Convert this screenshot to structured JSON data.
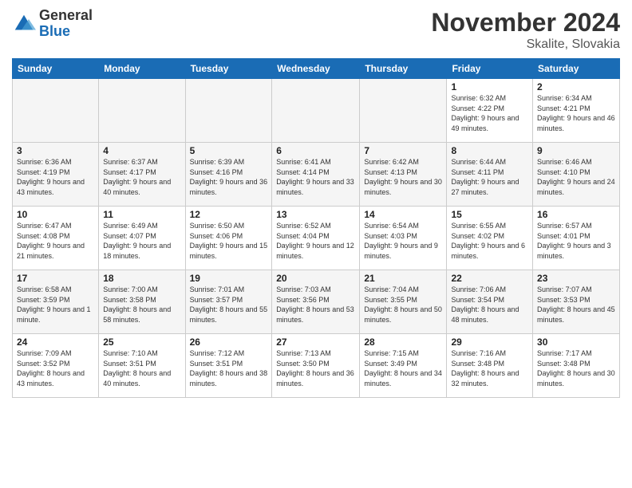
{
  "header": {
    "logo_text_general": "General",
    "logo_text_blue": "Blue",
    "month_title": "November 2024",
    "location": "Skalite, Slovakia"
  },
  "days_of_week": [
    "Sunday",
    "Monday",
    "Tuesday",
    "Wednesday",
    "Thursday",
    "Friday",
    "Saturday"
  ],
  "weeks": [
    [
      {
        "day": "",
        "empty": true
      },
      {
        "day": "",
        "empty": true
      },
      {
        "day": "",
        "empty": true
      },
      {
        "day": "",
        "empty": true
      },
      {
        "day": "",
        "empty": true
      },
      {
        "day": "1",
        "sunrise": "6:32 AM",
        "sunset": "4:22 PM",
        "daylight": "9 hours and 49 minutes."
      },
      {
        "day": "2",
        "sunrise": "6:34 AM",
        "sunset": "4:21 PM",
        "daylight": "9 hours and 46 minutes."
      }
    ],
    [
      {
        "day": "3",
        "sunrise": "6:36 AM",
        "sunset": "4:19 PM",
        "daylight": "9 hours and 43 minutes."
      },
      {
        "day": "4",
        "sunrise": "6:37 AM",
        "sunset": "4:17 PM",
        "daylight": "9 hours and 40 minutes."
      },
      {
        "day": "5",
        "sunrise": "6:39 AM",
        "sunset": "4:16 PM",
        "daylight": "9 hours and 36 minutes."
      },
      {
        "day": "6",
        "sunrise": "6:41 AM",
        "sunset": "4:14 PM",
        "daylight": "9 hours and 33 minutes."
      },
      {
        "day": "7",
        "sunrise": "6:42 AM",
        "sunset": "4:13 PM",
        "daylight": "9 hours and 30 minutes."
      },
      {
        "day": "8",
        "sunrise": "6:44 AM",
        "sunset": "4:11 PM",
        "daylight": "9 hours and 27 minutes."
      },
      {
        "day": "9",
        "sunrise": "6:46 AM",
        "sunset": "4:10 PM",
        "daylight": "9 hours and 24 minutes."
      }
    ],
    [
      {
        "day": "10",
        "sunrise": "6:47 AM",
        "sunset": "4:08 PM",
        "daylight": "9 hours and 21 minutes."
      },
      {
        "day": "11",
        "sunrise": "6:49 AM",
        "sunset": "4:07 PM",
        "daylight": "9 hours and 18 minutes."
      },
      {
        "day": "12",
        "sunrise": "6:50 AM",
        "sunset": "4:06 PM",
        "daylight": "9 hours and 15 minutes."
      },
      {
        "day": "13",
        "sunrise": "6:52 AM",
        "sunset": "4:04 PM",
        "daylight": "9 hours and 12 minutes."
      },
      {
        "day": "14",
        "sunrise": "6:54 AM",
        "sunset": "4:03 PM",
        "daylight": "9 hours and 9 minutes."
      },
      {
        "day": "15",
        "sunrise": "6:55 AM",
        "sunset": "4:02 PM",
        "daylight": "9 hours and 6 minutes."
      },
      {
        "day": "16",
        "sunrise": "6:57 AM",
        "sunset": "4:01 PM",
        "daylight": "9 hours and 3 minutes."
      }
    ],
    [
      {
        "day": "17",
        "sunrise": "6:58 AM",
        "sunset": "3:59 PM",
        "daylight": "9 hours and 1 minute."
      },
      {
        "day": "18",
        "sunrise": "7:00 AM",
        "sunset": "3:58 PM",
        "daylight": "8 hours and 58 minutes."
      },
      {
        "day": "19",
        "sunrise": "7:01 AM",
        "sunset": "3:57 PM",
        "daylight": "8 hours and 55 minutes."
      },
      {
        "day": "20",
        "sunrise": "7:03 AM",
        "sunset": "3:56 PM",
        "daylight": "8 hours and 53 minutes."
      },
      {
        "day": "21",
        "sunrise": "7:04 AM",
        "sunset": "3:55 PM",
        "daylight": "8 hours and 50 minutes."
      },
      {
        "day": "22",
        "sunrise": "7:06 AM",
        "sunset": "3:54 PM",
        "daylight": "8 hours and 48 minutes."
      },
      {
        "day": "23",
        "sunrise": "7:07 AM",
        "sunset": "3:53 PM",
        "daylight": "8 hours and 45 minutes."
      }
    ],
    [
      {
        "day": "24",
        "sunrise": "7:09 AM",
        "sunset": "3:52 PM",
        "daylight": "8 hours and 43 minutes."
      },
      {
        "day": "25",
        "sunrise": "7:10 AM",
        "sunset": "3:51 PM",
        "daylight": "8 hours and 40 minutes."
      },
      {
        "day": "26",
        "sunrise": "7:12 AM",
        "sunset": "3:51 PM",
        "daylight": "8 hours and 38 minutes."
      },
      {
        "day": "27",
        "sunrise": "7:13 AM",
        "sunset": "3:50 PM",
        "daylight": "8 hours and 36 minutes."
      },
      {
        "day": "28",
        "sunrise": "7:15 AM",
        "sunset": "3:49 PM",
        "daylight": "8 hours and 34 minutes."
      },
      {
        "day": "29",
        "sunrise": "7:16 AM",
        "sunset": "3:48 PM",
        "daylight": "8 hours and 32 minutes."
      },
      {
        "day": "30",
        "sunrise": "7:17 AM",
        "sunset": "3:48 PM",
        "daylight": "8 hours and 30 minutes."
      }
    ]
  ]
}
